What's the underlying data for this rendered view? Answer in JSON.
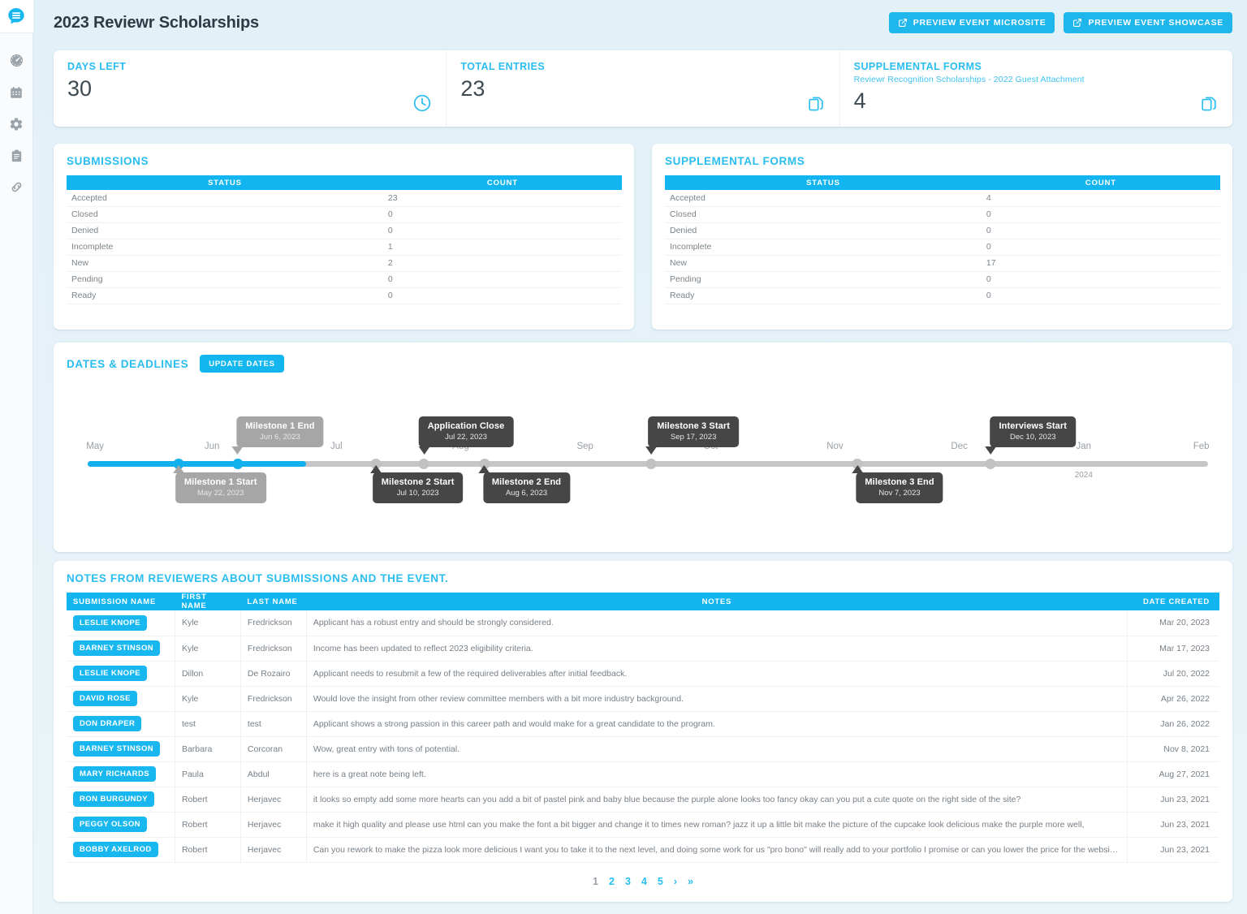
{
  "sidebar": {
    "logo": {
      "name": "reviewr-logo",
      "color": "#18b7f0"
    },
    "items": [
      {
        "icon": "dashboard-gauge-icon",
        "label": "Dashboard"
      },
      {
        "icon": "calendar-icon",
        "label": "Calendar"
      },
      {
        "icon": "gear-icon",
        "label": "Settings"
      },
      {
        "icon": "clipboard-icon",
        "label": "Forms"
      },
      {
        "icon": "link-icon",
        "label": "Links"
      }
    ]
  },
  "header": {
    "title": "2023 Reviewr Scholarships",
    "buttons": [
      {
        "label": "PREVIEW EVENT MICROSITE",
        "icon": "external-link-icon"
      },
      {
        "label": "PREVIEW EVENT SHOWCASE",
        "icon": "external-link-icon"
      }
    ]
  },
  "stats": [
    {
      "label": "DAYS LEFT",
      "sub": "",
      "value": "30",
      "icon": "clock-icon"
    },
    {
      "label": "TOTAL ENTRIES",
      "sub": "",
      "value": "23",
      "icon": "copy-icon"
    },
    {
      "label": "SUPPLEMENTAL FORMS",
      "sub": "Reviewr Recognition Scholarships - 2022 Guest Attachment",
      "value": "4",
      "icon": "copy-icon"
    }
  ],
  "submissions": {
    "title": "SUBMISSIONS",
    "columns": [
      "STATUS",
      "COUNT"
    ],
    "rows": [
      [
        "Accepted",
        "23"
      ],
      [
        "Closed",
        "0"
      ],
      [
        "Denied",
        "0"
      ],
      [
        "Incomplete",
        "1"
      ],
      [
        "New",
        "2"
      ],
      [
        "Pending",
        "0"
      ],
      [
        "Ready",
        "0"
      ]
    ]
  },
  "supplemental": {
    "title": "SUPPLEMENTAL FORMS",
    "columns": [
      "STATUS",
      "COUNT"
    ],
    "rows": [
      [
        "Accepted",
        "4"
      ],
      [
        "Closed",
        "0"
      ],
      [
        "Denied",
        "0"
      ],
      [
        "Incomplete",
        "0"
      ],
      [
        "New",
        "17"
      ],
      [
        "Pending",
        "0"
      ],
      [
        "Ready",
        "0"
      ]
    ]
  },
  "timeline": {
    "title": "DATES & DEADLINES",
    "update_button": "UPDATE DATES",
    "ticks": [
      {
        "label": "May",
        "pct": 0
      },
      {
        "label": "Jun",
        "pct": 11.1
      },
      {
        "label": "Jul",
        "pct": 22.2
      },
      {
        "label": "Aug",
        "pct": 33.3
      },
      {
        "label": "Sep",
        "pct": 44.4
      },
      {
        "label": "Oct",
        "pct": 55.6
      },
      {
        "label": "Nov",
        "pct": 66.7
      },
      {
        "label": "Dec",
        "pct": 77.8
      },
      {
        "label": "Jan",
        "pct": 88.9
      },
      {
        "label": "Feb",
        "pct": 100
      }
    ],
    "year_marker": {
      "label": "2024",
      "pct": 88.9
    },
    "fill_pct": 19.5,
    "milestones": [
      {
        "title": "Milestone 1 Start",
        "date": "May 22, 2023",
        "pct": 8.1,
        "side": "below",
        "tone": "grey",
        "dot": "active"
      },
      {
        "title": "Milestone 1 End",
        "date": "Jun 6, 2023",
        "pct": 13.4,
        "side": "above",
        "tone": "grey",
        "dot": "active"
      },
      {
        "title": "Milestone 2 Start",
        "date": "Jul 10, 2023",
        "pct": 25.7,
        "side": "below",
        "tone": "dark",
        "dot": "inactive"
      },
      {
        "title": "Application Close",
        "date": "Jul 22, 2023",
        "pct": 30.0,
        "side": "above",
        "tone": "dark",
        "dot": "inactive"
      },
      {
        "title": "Milestone 2 End",
        "date": "Aug 6, 2023",
        "pct": 35.4,
        "side": "below",
        "tone": "dark",
        "dot": "inactive"
      },
      {
        "title": "Milestone 3 Start",
        "date": "Sep 17, 2023",
        "pct": 50.3,
        "side": "above",
        "tone": "dark",
        "dot": "inactive"
      },
      {
        "title": "Milestone 3 End",
        "date": "Nov 7, 2023",
        "pct": 68.7,
        "side": "below",
        "tone": "dark",
        "dot": "inactive"
      },
      {
        "title": "Interviews Start",
        "date": "Dec 10, 2023",
        "pct": 80.6,
        "side": "above",
        "tone": "dark",
        "dot": "inactive"
      }
    ]
  },
  "notes": {
    "title": "NOTES FROM REVIEWERS ABOUT SUBMISSIONS AND THE EVENT.",
    "columns": [
      "SUBMISSION NAME",
      "FIRST NAME",
      "LAST NAME",
      "NOTES",
      "DATE CREATED"
    ],
    "rows": [
      {
        "submission": "LESLIE KNOPE",
        "first": "Kyle",
        "last": "Fredrickson",
        "note": "Applicant has a robust entry and should be strongly considered.",
        "date": "Mar 20, 2023"
      },
      {
        "submission": "BARNEY STINSON",
        "first": "Kyle",
        "last": "Fredrickson",
        "note": "Income has been updated to reflect 2023 eligibility criteria.",
        "date": "Mar 17, 2023"
      },
      {
        "submission": "LESLIE KNOPE",
        "first": "Dillon",
        "last": "De Rozairo",
        "note": "Applicant needs to resubmit a few of the required deliverables after initial feedback.",
        "date": "Jul 20, 2022"
      },
      {
        "submission": "DAVID ROSE",
        "first": "Kyle",
        "last": "Fredrickson",
        "note": "Would love the insight from other review committee members with a bit more industry background.",
        "date": "Apr 26, 2022"
      },
      {
        "submission": "DON DRAPER",
        "first": "test",
        "last": "test",
        "note": "Applicant shows a strong passion in this career path and would make for a great candidate to the program.",
        "date": "Jan 26, 2022"
      },
      {
        "submission": "BARNEY STINSON",
        "first": "Barbara",
        "last": "Corcoran",
        "note": "Wow, great entry with tons of potential.",
        "date": "Nov 8, 2021"
      },
      {
        "submission": "MARY RICHARDS",
        "first": "Paula",
        "last": "Abdul",
        "note": "here is a great note being left.",
        "date": "Aug 27, 2021"
      },
      {
        "submission": "RON BURGUNDY",
        "first": "Robert",
        "last": "Herjavec",
        "note": "it looks so empty add some more hearts can you add a bit of pastel pink and baby blue because the purple alone looks too fancy okay can you put a cute quote on the right side of the site?",
        "date": "Jun 23, 2021"
      },
      {
        "submission": "PEGGY OLSON",
        "first": "Robert",
        "last": "Herjavec",
        "note": "make it high quality and please use html can you make the font a bit bigger and change it to times new roman? jazz it up a little bit make the picture of the cupcake look delicious make the purple more well,",
        "date": "Jun 23, 2021"
      },
      {
        "submission": "BOBBY AXELROD",
        "first": "Robert",
        "last": "Herjavec",
        "note": "Can you rework to make the pizza look more delicious I want you to take it to the next level, and doing some work for us \"pro bono\" will really add to your portfolio I promise or can you lower the price for the website?",
        "date": "Jun 23, 2021"
      }
    ],
    "pagination": {
      "current": "1",
      "pages": [
        "2",
        "3",
        "4",
        "5"
      ],
      "next": "›",
      "last": "»"
    }
  },
  "colors": {
    "accent": "#12b5ef",
    "accent_light": "#29bdf0",
    "bubble_dark": "#464646",
    "bubble_grey": "#a6a6a6",
    "track": "#c6c6c6"
  }
}
